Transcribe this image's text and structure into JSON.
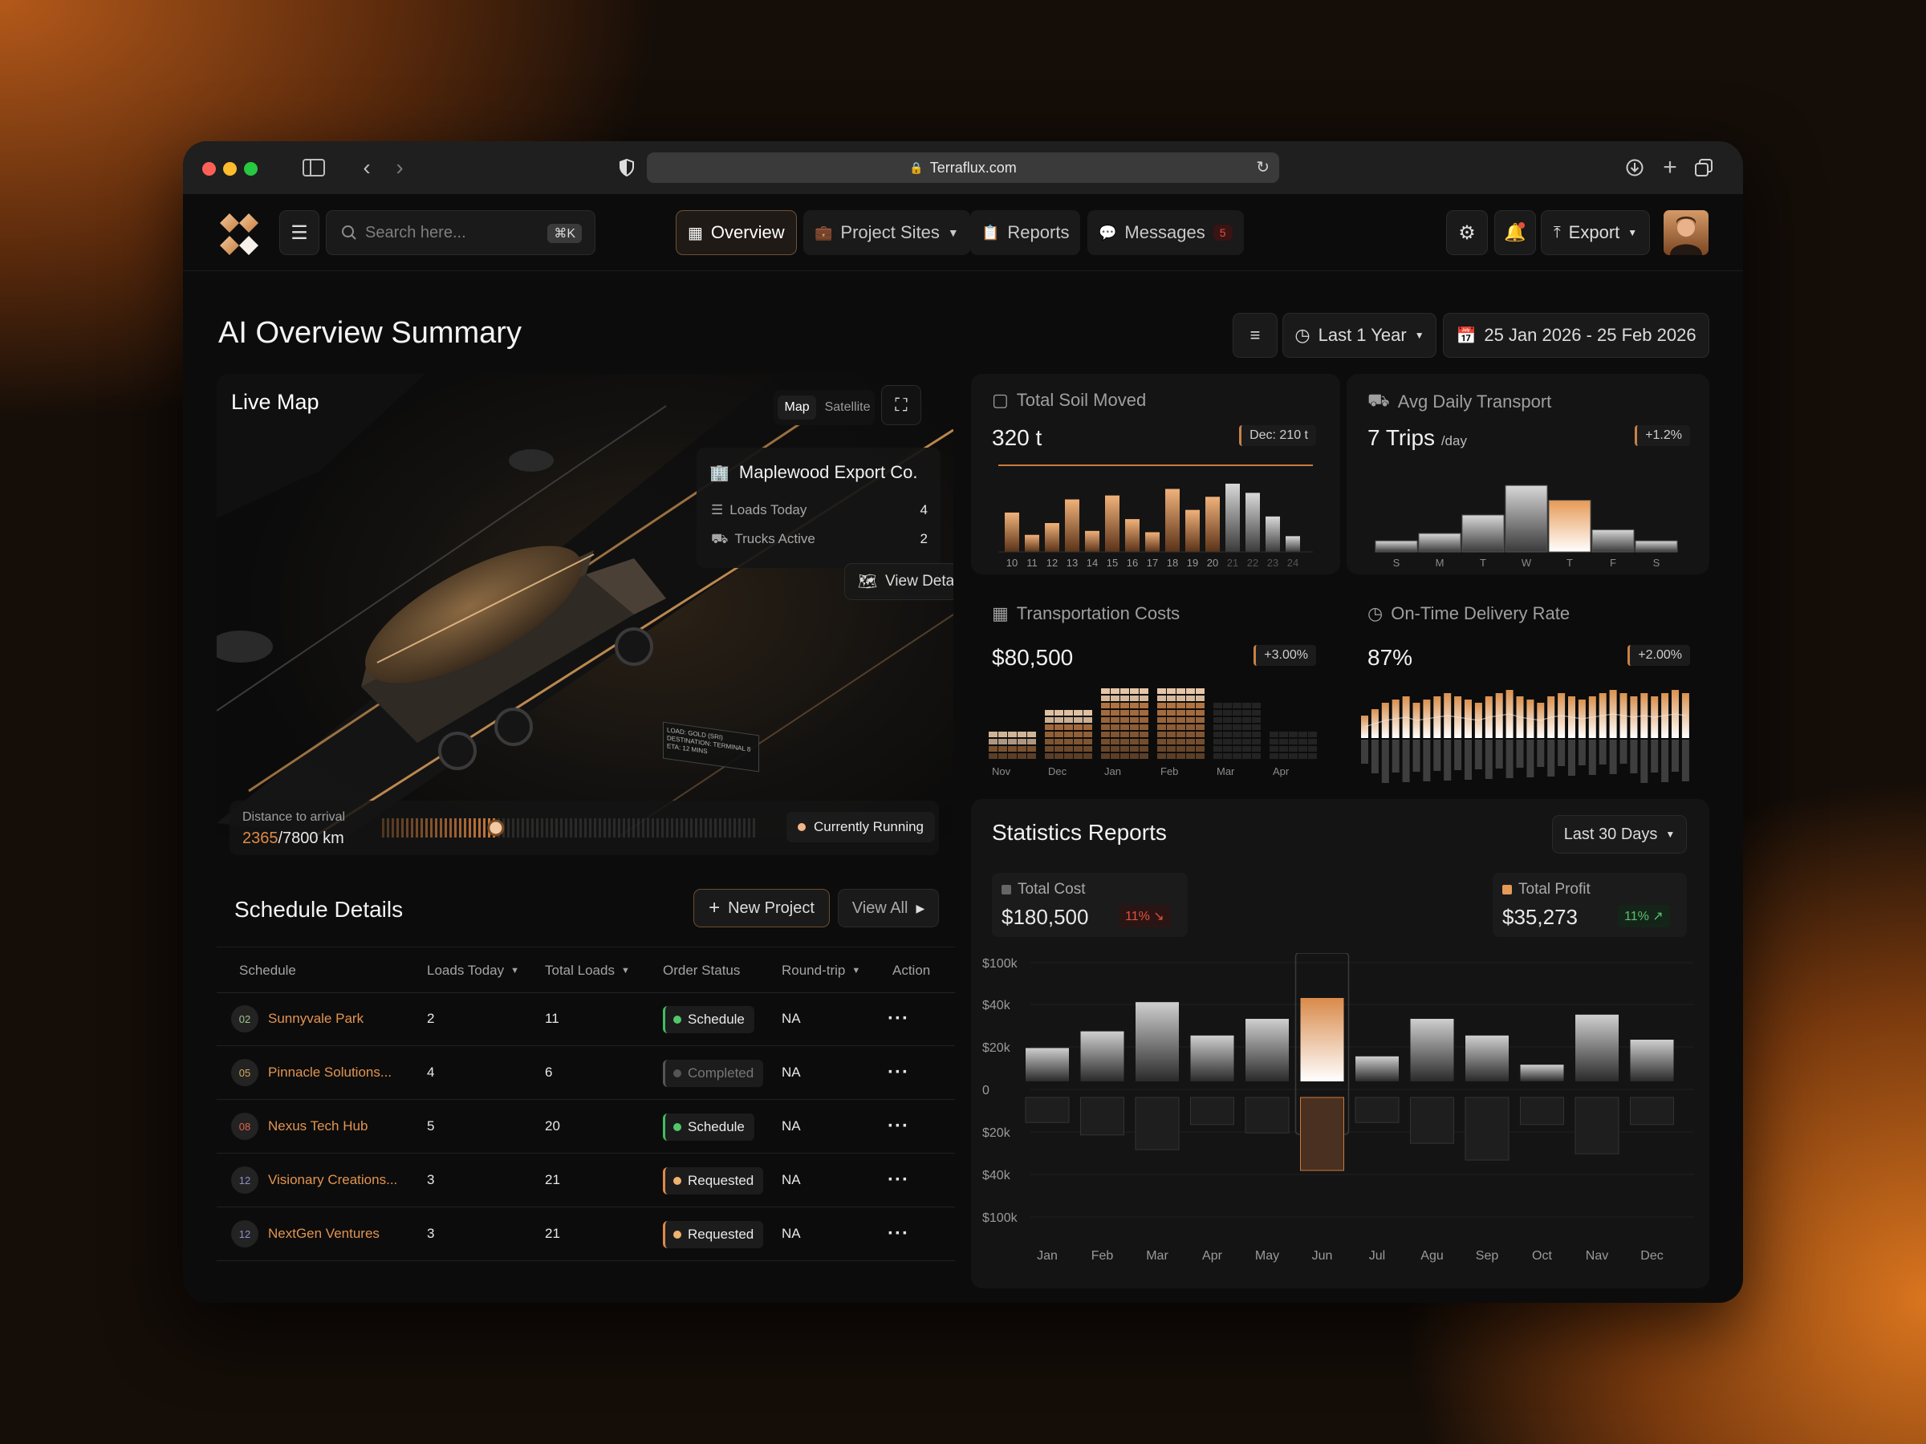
{
  "browser": {
    "url": "Terraflux.com"
  },
  "header": {
    "search_placeholder": "Search here...",
    "search_shortcut": "⌘K",
    "nav": [
      {
        "label": "Overview",
        "icon": "grid-icon",
        "active": true
      },
      {
        "label": "Project Sites",
        "icon": "briefcase-icon",
        "dropdown": true
      },
      {
        "label": "Reports",
        "icon": "report-icon"
      },
      {
        "label": "Messages",
        "icon": "chat-icon",
        "badge": "5"
      }
    ],
    "export_label": "Export"
  },
  "page": {
    "title": "AI Overview Summary",
    "range_label": "Last 1 Year",
    "date_range": "25 Jan 2026 - 25 Feb 2026"
  },
  "live_map": {
    "title": "Live Map",
    "toggle": [
      "Map",
      "Satellite"
    ],
    "popup": {
      "company": "Maplewood Export Co.",
      "loads_label": "Loads Today",
      "loads_value": "4",
      "trucks_label": "Trucks Active",
      "trucks_value": "2",
      "details_label": "View Details"
    },
    "truck_tag": [
      "LOAD: GOLD (SRI)",
      "DESTINATION: TERMINAL 8",
      "ETA: 12 MINS"
    ],
    "distance_label": "Distance to arrival",
    "distance_done": "2365",
    "distance_total": "/7800 km",
    "progress": 0.303,
    "status_label": "Currently Running"
  },
  "schedule": {
    "title": "Schedule Details",
    "new_label": "New Project",
    "view_all_label": "View All",
    "columns": [
      "Schedule",
      "Loads Today",
      "Total Loads",
      "Order Status",
      "Round-trip",
      "Action"
    ],
    "rows": [
      {
        "num": "02",
        "name": "Sunnyvale Park",
        "loads": "2",
        "total": "11",
        "status": "Schedule",
        "trip": "NA"
      },
      {
        "num": "05",
        "name": "Pinnacle Solutions...",
        "loads": "4",
        "total": "6",
        "status": "Completed",
        "trip": "NA"
      },
      {
        "num": "08",
        "name": "Nexus Tech Hub",
        "loads": "5",
        "total": "20",
        "status": "Schedule",
        "trip": "NA"
      },
      {
        "num": "12",
        "name": "Visionary Creations...",
        "loads": "3",
        "total": "21",
        "status": "Requested",
        "trip": "NA"
      },
      {
        "num": "12",
        "name": "NextGen Ventures",
        "loads": "3",
        "total": "21",
        "status": "Requested",
        "trip": "NA"
      }
    ]
  },
  "metrics": {
    "soil": {
      "title": "Total Soil Moved",
      "value": "320 t",
      "delta": "Dec: 210 t"
    },
    "transport": {
      "title": "Avg Daily Transport",
      "value": "7 Trips",
      "unit": "/day",
      "delta": "+1.2%"
    },
    "costs": {
      "title": "Transportation Costs",
      "value": "$80,500",
      "delta": "+3.00%"
    },
    "ontime": {
      "title": "On-Time Delivery Rate",
      "value": "87%",
      "delta": "+2.00%"
    }
  },
  "stats": {
    "title": "Statistics Reports",
    "range_label": "Last 30 Days",
    "cost_label": "Total Cost",
    "cost_value": "$180,500",
    "cost_delta": "11%",
    "profit_label": "Total Profit",
    "profit_value": "$35,273",
    "profit_delta": "11%"
  },
  "chart_data": [
    {
      "type": "bar",
      "title": "Total Soil Moved",
      "categories": [
        "10",
        "11",
        "12",
        "13",
        "14",
        "15",
        "16",
        "17",
        "18",
        "19",
        "20",
        "21",
        "22",
        "23",
        "24"
      ],
      "values": [
        30,
        13,
        22,
        40,
        16,
        43,
        25,
        15,
        48,
        32,
        42,
        52,
        45,
        27,
        12
      ],
      "highlight_until": "20"
    },
    {
      "type": "bar",
      "title": "Avg Daily Transport",
      "categories": [
        "S",
        "M",
        "T",
        "W",
        "T",
        "F",
        "S"
      ],
      "values": [
        1.5,
        2.5,
        5,
        9,
        7,
        3,
        1.5
      ],
      "highlight": "T"
    },
    {
      "type": "bar",
      "title": "Transportation Costs",
      "categories": [
        "Nov",
        "Dec",
        "Jan",
        "Feb",
        "Mar",
        "Apr"
      ],
      "values": [
        4,
        7,
        10,
        10,
        8,
        4
      ]
    },
    {
      "type": "bar",
      "title": "On-Time Delivery Rate",
      "values": [
        80,
        82,
        84,
        85,
        86,
        84,
        85,
        86,
        87,
        86,
        85,
        84,
        86,
        87,
        88,
        86,
        85,
        84,
        86,
        87,
        86,
        85,
        86,
        87,
        88,
        87,
        86,
        87,
        86,
        87,
        88,
        87
      ]
    },
    {
      "type": "bar",
      "title": "Statistics Reports",
      "categories": [
        "Jan",
        "Feb",
        "Mar",
        "Apr",
        "May",
        "Jun",
        "Jul",
        "Agu",
        "Sep",
        "Oct",
        "Nav",
        "Dec"
      ],
      "yticks": [
        "$100k",
        "$40k",
        "$20k",
        "0",
        "$20k",
        "$40k",
        "$100k"
      ],
      "series": [
        {
          "name": "Total Profit",
          "values": [
            16,
            24,
            38,
            22,
            30,
            40,
            12,
            30,
            22,
            8,
            32,
            20
          ]
        },
        {
          "name": "Total Cost",
          "values": [
            -12,
            -18,
            -25,
            -13,
            -17,
            -35,
            -12,
            -22,
            -30,
            -13,
            -27,
            -13
          ]
        }
      ],
      "highlight": "Jun"
    }
  ]
}
